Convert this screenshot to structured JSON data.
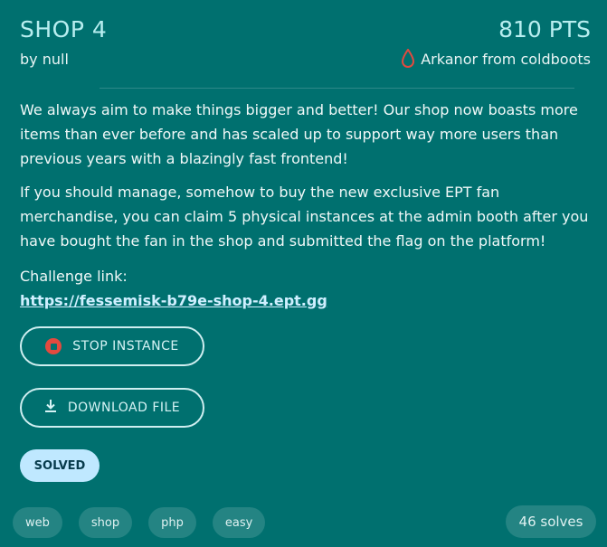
{
  "challenge": {
    "title": "SHOP 4",
    "points": "810 PTS",
    "author": "by null",
    "first_blood": "Arkanor from coldboots",
    "first_blood_icon": "blood-drop-icon"
  },
  "description": {
    "paragraphs": [
      "We always aim to make things bigger and better! Our shop now boasts more items than ever before and has scaled up to support way more users than previous years with a blazingly fast frontend!",
      "If you should manage, somehow to buy the new exclusive EPT fan merchandise, you can claim 5 physical instances at the admin booth after you have bought the fan in the shop and submitted the flag on the platform!"
    ]
  },
  "link": {
    "label": "Challenge link:",
    "url": "https://fessemisk-b79e-shop-4.ept.gg"
  },
  "actions": {
    "stop_label": "STOP INSTANCE",
    "download_label": "DOWNLOAD FILE"
  },
  "status": {
    "badge": "SOLVED"
  },
  "tags": [
    "web",
    "shop",
    "php",
    "easy"
  ],
  "solves": "46 solves",
  "colors": {
    "background": "#00706f",
    "accent": "#b8eef0",
    "blood": "#e24a3f",
    "solved_badge": "#bfe8ff"
  }
}
